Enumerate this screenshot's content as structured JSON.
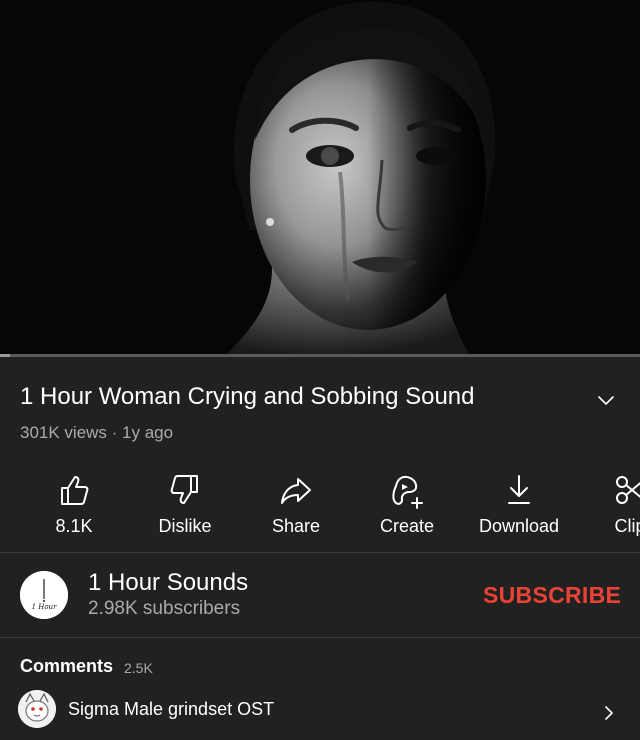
{
  "video": {
    "title": "1 Hour Woman Crying and Sobbing Sound",
    "meta": "301K views · 1y ago",
    "progress_fraction": 0.015
  },
  "actions": [
    {
      "name": "like-button",
      "icon": "thumbs-up-icon",
      "label": "8.1K"
    },
    {
      "name": "dislike-button",
      "icon": "thumbs-down-icon",
      "label": "Dislike"
    },
    {
      "name": "share-button",
      "icon": "share-arrow-icon",
      "label": "Share"
    },
    {
      "name": "create-button",
      "icon": "create-sparkle-icon",
      "label": "Create"
    },
    {
      "name": "download-button",
      "icon": "download-arrow-icon",
      "label": "Download"
    },
    {
      "name": "clip-button",
      "icon": "scissors-icon",
      "label": "Clip"
    }
  ],
  "channel": {
    "name": "1 Hour Sounds",
    "subscribers": "2.98K subscribers",
    "avatar_text": "1 Hour",
    "subscribe_label": "SUBSCRIBE"
  },
  "comments": {
    "label": "Comments",
    "count": "2.5K",
    "preview_text": "Sigma Male grindset OST"
  },
  "colors": {
    "background": "#212121",
    "subscribe": "#ea4335",
    "secondary_text": "#aaaaaa"
  }
}
